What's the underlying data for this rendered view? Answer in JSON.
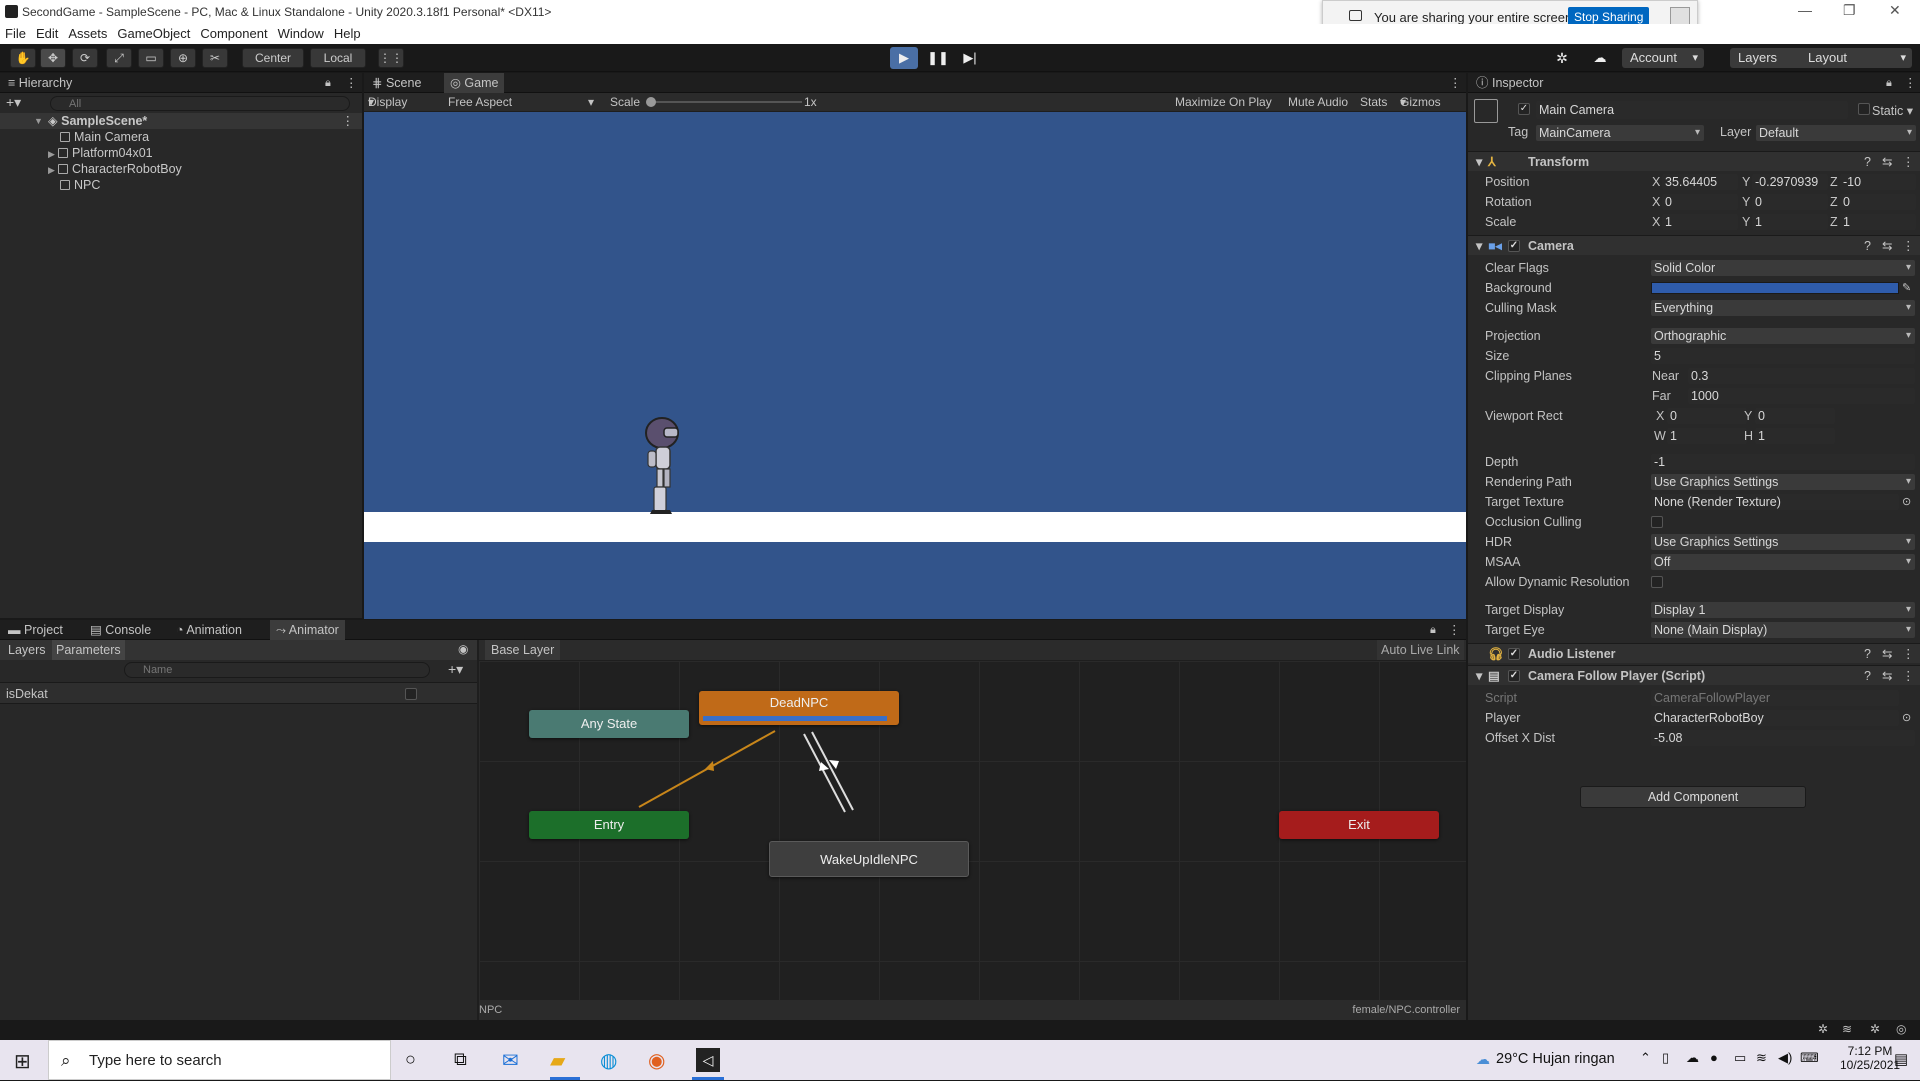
{
  "window": {
    "title": "SecondGame - SampleScene - PC, Mac & Linux Standalone - Unity 2020.3.18f1 Personal* <DX11>"
  },
  "share_bar": {
    "message": "You are sharing your entire screen.",
    "stop_label": "Stop Sharing"
  },
  "menu": [
    "File",
    "Edit",
    "Assets",
    "GameObject",
    "Component",
    "Window",
    "Help"
  ],
  "toolbar": {
    "pivot": "Center",
    "space": "Local",
    "account": "Account",
    "layers": "Layers",
    "layout": "Layout"
  },
  "hierarchy": {
    "title": "Hierarchy",
    "search_placeholder": "All",
    "scene": "SampleScene*",
    "items": [
      "Main Camera",
      "Platform04x01",
      "CharacterRobotBoy",
      "NPC"
    ]
  },
  "game": {
    "tab_scene": "Scene",
    "tab_game": "Game",
    "display": "Display 1",
    "aspect": "Free Aspect",
    "scale_label": "Scale",
    "scale_value": "1x",
    "maximize": "Maximize On Play",
    "mute": "Mute Audio",
    "stats": "Stats",
    "gizmos": "Gizmos",
    "colors": {
      "sky": "#32548b",
      "platform": "#ffffff"
    }
  },
  "inspector": {
    "title": "Inspector",
    "object_name": "Main Camera",
    "static_label": "Static",
    "tag_label": "Tag",
    "tag_value": "MainCamera",
    "layer_label": "Layer",
    "layer_value": "Default",
    "transform": {
      "title": "Transform",
      "position_label": "Position",
      "rotation_label": "Rotation",
      "scale_label": "Scale",
      "position": [
        "35.64405",
        "-0.2970939",
        "-10"
      ],
      "rotation": [
        "0",
        "0",
        "0"
      ],
      "scale": [
        "1",
        "1",
        "1"
      ]
    },
    "camera": {
      "title": "Camera",
      "clear_flags_label": "Clear Flags",
      "clear_flags": "Solid Color",
      "background_label": "Background",
      "background_color": "#2f5cab",
      "culling_mask_label": "Culling Mask",
      "culling_mask": "Everything",
      "projection_label": "Projection",
      "projection": "Orthographic",
      "size_label": "Size",
      "size": "5",
      "clipping_label": "Clipping Planes",
      "near_label": "Near",
      "near": "0.3",
      "far_label": "Far",
      "far": "1000",
      "viewport_label": "Viewport Rect",
      "vx": "0",
      "vy": "0",
      "vw": "1",
      "vh": "1",
      "depth_label": "Depth",
      "depth": "-1",
      "rendering_path_label": "Rendering Path",
      "rendering_path": "Use Graphics Settings",
      "target_texture_label": "Target Texture",
      "target_texture": "None (Render Texture)",
      "occlusion_label": "Occlusion Culling",
      "hdr_label": "HDR",
      "hdr": "Use Graphics Settings",
      "msaa_label": "MSAA",
      "msaa": "Off",
      "dynres_label": "Allow Dynamic Resolution",
      "target_display_label": "Target Display",
      "target_display": "Display 1",
      "target_eye_label": "Target Eye",
      "target_eye": "None (Main Display)"
    },
    "audio_listener": "Audio Listener",
    "follow": {
      "title": "Camera Follow Player (Script)",
      "script_label": "Script",
      "script": "CameraFollowPlayer",
      "player_label": "Player",
      "player": "CharacterRobotBoy",
      "offset_label": "Offset X Dist",
      "offset": "-5.08"
    },
    "add_component": "Add Component"
  },
  "bottom_tabs": [
    "Project",
    "Console",
    "Animation",
    "Animator"
  ],
  "animator": {
    "layers_tab": "Layers",
    "parameters_tab": "Parameters",
    "search_placeholder": "Name",
    "param_name": "isDekat",
    "breadcrumb": "Base Layer",
    "auto_live": "Auto Live Link",
    "states": {
      "any": "Any State",
      "dead": "DeadNPC",
      "entry": "Entry",
      "wake": "WakeUpIdleNPC",
      "exit": "Exit"
    },
    "footer_left": "NPC",
    "footer_right": "female/NPC.controller",
    "colors": {
      "any": "#4a7a72",
      "dead": "#c06a18",
      "entry": "#1c6f2a",
      "wake": "#3e3e3e",
      "exit": "#a51c1c"
    }
  },
  "taskbar": {
    "search": "Type here to search",
    "weather": "29°C Hujan ringan",
    "time": "7:12 PM",
    "date": "10/25/2021"
  }
}
